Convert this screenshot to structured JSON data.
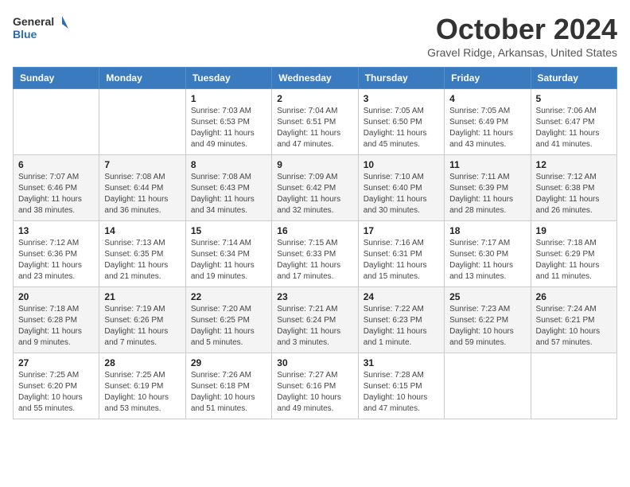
{
  "header": {
    "logo_line1": "General",
    "logo_line2": "Blue",
    "month_title": "October 2024",
    "location": "Gravel Ridge, Arkansas, United States"
  },
  "days_of_week": [
    "Sunday",
    "Monday",
    "Tuesday",
    "Wednesday",
    "Thursday",
    "Friday",
    "Saturday"
  ],
  "weeks": [
    [
      {
        "day": "",
        "info": ""
      },
      {
        "day": "",
        "info": ""
      },
      {
        "day": "1",
        "info": "Sunrise: 7:03 AM\nSunset: 6:53 PM\nDaylight: 11 hours and 49 minutes."
      },
      {
        "day": "2",
        "info": "Sunrise: 7:04 AM\nSunset: 6:51 PM\nDaylight: 11 hours and 47 minutes."
      },
      {
        "day": "3",
        "info": "Sunrise: 7:05 AM\nSunset: 6:50 PM\nDaylight: 11 hours and 45 minutes."
      },
      {
        "day": "4",
        "info": "Sunrise: 7:05 AM\nSunset: 6:49 PM\nDaylight: 11 hours and 43 minutes."
      },
      {
        "day": "5",
        "info": "Sunrise: 7:06 AM\nSunset: 6:47 PM\nDaylight: 11 hours and 41 minutes."
      }
    ],
    [
      {
        "day": "6",
        "info": "Sunrise: 7:07 AM\nSunset: 6:46 PM\nDaylight: 11 hours and 38 minutes."
      },
      {
        "day": "7",
        "info": "Sunrise: 7:08 AM\nSunset: 6:44 PM\nDaylight: 11 hours and 36 minutes."
      },
      {
        "day": "8",
        "info": "Sunrise: 7:08 AM\nSunset: 6:43 PM\nDaylight: 11 hours and 34 minutes."
      },
      {
        "day": "9",
        "info": "Sunrise: 7:09 AM\nSunset: 6:42 PM\nDaylight: 11 hours and 32 minutes."
      },
      {
        "day": "10",
        "info": "Sunrise: 7:10 AM\nSunset: 6:40 PM\nDaylight: 11 hours and 30 minutes."
      },
      {
        "day": "11",
        "info": "Sunrise: 7:11 AM\nSunset: 6:39 PM\nDaylight: 11 hours and 28 minutes."
      },
      {
        "day": "12",
        "info": "Sunrise: 7:12 AM\nSunset: 6:38 PM\nDaylight: 11 hours and 26 minutes."
      }
    ],
    [
      {
        "day": "13",
        "info": "Sunrise: 7:12 AM\nSunset: 6:36 PM\nDaylight: 11 hours and 23 minutes."
      },
      {
        "day": "14",
        "info": "Sunrise: 7:13 AM\nSunset: 6:35 PM\nDaylight: 11 hours and 21 minutes."
      },
      {
        "day": "15",
        "info": "Sunrise: 7:14 AM\nSunset: 6:34 PM\nDaylight: 11 hours and 19 minutes."
      },
      {
        "day": "16",
        "info": "Sunrise: 7:15 AM\nSunset: 6:33 PM\nDaylight: 11 hours and 17 minutes."
      },
      {
        "day": "17",
        "info": "Sunrise: 7:16 AM\nSunset: 6:31 PM\nDaylight: 11 hours and 15 minutes."
      },
      {
        "day": "18",
        "info": "Sunrise: 7:17 AM\nSunset: 6:30 PM\nDaylight: 11 hours and 13 minutes."
      },
      {
        "day": "19",
        "info": "Sunrise: 7:18 AM\nSunset: 6:29 PM\nDaylight: 11 hours and 11 minutes."
      }
    ],
    [
      {
        "day": "20",
        "info": "Sunrise: 7:18 AM\nSunset: 6:28 PM\nDaylight: 11 hours and 9 minutes."
      },
      {
        "day": "21",
        "info": "Sunrise: 7:19 AM\nSunset: 6:26 PM\nDaylight: 11 hours and 7 minutes."
      },
      {
        "day": "22",
        "info": "Sunrise: 7:20 AM\nSunset: 6:25 PM\nDaylight: 11 hours and 5 minutes."
      },
      {
        "day": "23",
        "info": "Sunrise: 7:21 AM\nSunset: 6:24 PM\nDaylight: 11 hours and 3 minutes."
      },
      {
        "day": "24",
        "info": "Sunrise: 7:22 AM\nSunset: 6:23 PM\nDaylight: 11 hours and 1 minute."
      },
      {
        "day": "25",
        "info": "Sunrise: 7:23 AM\nSunset: 6:22 PM\nDaylight: 10 hours and 59 minutes."
      },
      {
        "day": "26",
        "info": "Sunrise: 7:24 AM\nSunset: 6:21 PM\nDaylight: 10 hours and 57 minutes."
      }
    ],
    [
      {
        "day": "27",
        "info": "Sunrise: 7:25 AM\nSunset: 6:20 PM\nDaylight: 10 hours and 55 minutes."
      },
      {
        "day": "28",
        "info": "Sunrise: 7:25 AM\nSunset: 6:19 PM\nDaylight: 10 hours and 53 minutes."
      },
      {
        "day": "29",
        "info": "Sunrise: 7:26 AM\nSunset: 6:18 PM\nDaylight: 10 hours and 51 minutes."
      },
      {
        "day": "30",
        "info": "Sunrise: 7:27 AM\nSunset: 6:16 PM\nDaylight: 10 hours and 49 minutes."
      },
      {
        "day": "31",
        "info": "Sunrise: 7:28 AM\nSunset: 6:15 PM\nDaylight: 10 hours and 47 minutes."
      },
      {
        "day": "",
        "info": ""
      },
      {
        "day": "",
        "info": ""
      }
    ]
  ]
}
